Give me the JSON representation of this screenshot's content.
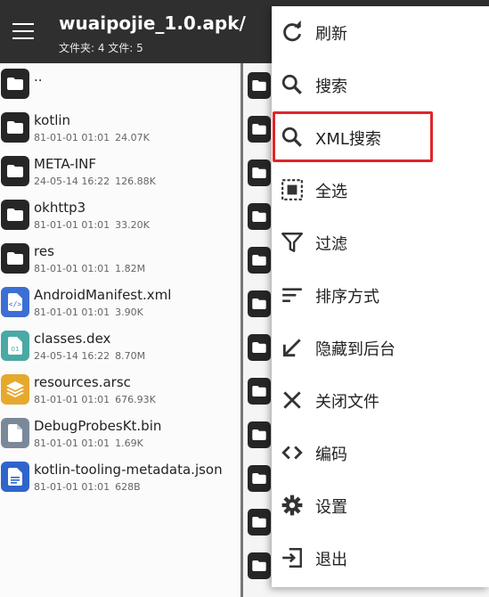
{
  "header": {
    "title": "wuaipojie_1.0.apk/",
    "subtitle": "文件夹: 4  文件: 5"
  },
  "files": [
    {
      "name": "..",
      "date": "",
      "size": "",
      "type": "folder"
    },
    {
      "name": "kotlin",
      "date": "81-01-01 01:01",
      "size": "24.07K",
      "type": "folder"
    },
    {
      "name": "META-INF",
      "date": "24-05-14 16:22",
      "size": "126.88K",
      "type": "folder"
    },
    {
      "name": "okhttp3",
      "date": "81-01-01 01:01",
      "size": "33.20K",
      "type": "folder"
    },
    {
      "name": "res",
      "date": "81-01-01 01:01",
      "size": "1.82M",
      "type": "folder"
    },
    {
      "name": "AndroidManifest.xml",
      "date": "81-01-01 01:01",
      "size": "3.90K",
      "type": "xml"
    },
    {
      "name": "classes.dex",
      "date": "24-05-14 16:22",
      "size": "8.70M",
      "type": "dex"
    },
    {
      "name": "resources.arsc",
      "date": "81-01-01 01:01",
      "size": "676.93K",
      "type": "arsc"
    },
    {
      "name": "DebugProbesKt.bin",
      "date": "81-01-01 01:01",
      "size": "1.69K",
      "type": "bin"
    },
    {
      "name": "kotlin-tooling-metadata.json",
      "date": "81-01-01 01:01",
      "size": "628B",
      "type": "json"
    }
  ],
  "menu": [
    {
      "label": "刷新",
      "icon": "refresh-icon"
    },
    {
      "label": "搜索",
      "icon": "search-icon"
    },
    {
      "label": "XML搜索",
      "icon": "search-icon",
      "highlighted": true
    },
    {
      "label": "全选",
      "icon": "select-all-icon"
    },
    {
      "label": "过滤",
      "icon": "filter-icon"
    },
    {
      "label": "排序方式",
      "icon": "sort-icon"
    },
    {
      "label": "隐藏到后台",
      "icon": "arrow-down-left-icon"
    },
    {
      "label": "关闭文件",
      "icon": "close-icon"
    },
    {
      "label": "编码",
      "icon": "code-icon"
    },
    {
      "label": "设置",
      "icon": "gear-icon"
    },
    {
      "label": "退出",
      "icon": "exit-icon"
    }
  ],
  "colors": {
    "appbar": "#2f2f2f",
    "highlight_box": "#e0252b",
    "folder_icon": "#262626"
  }
}
